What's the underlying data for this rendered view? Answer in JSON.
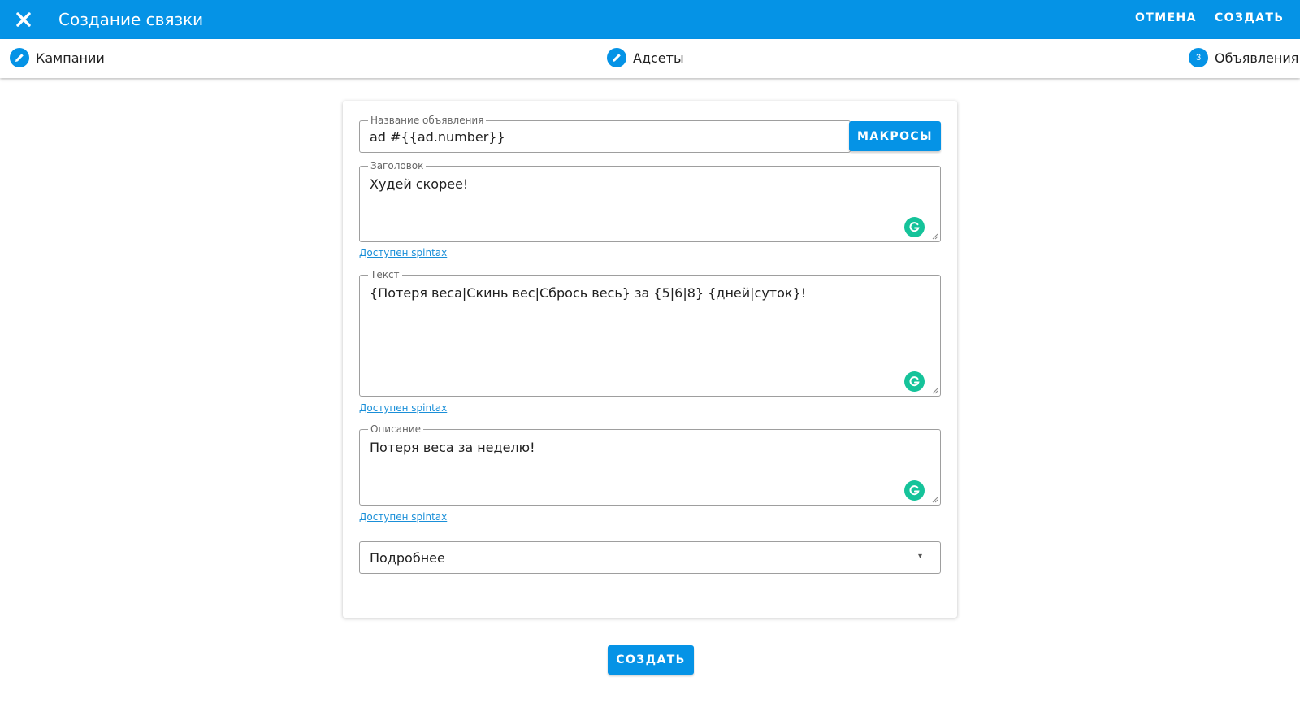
{
  "header": {
    "title": "Создание связки",
    "close_icon": "close-icon",
    "cancel_label": "ОТМЕНА",
    "create_label": "СОЗДАТЬ",
    "bg_color": "#0593e6"
  },
  "stepper": {
    "steps": [
      {
        "label": "Кампании",
        "icon": "pencil-icon",
        "state": "done"
      },
      {
        "label": "Адсеты",
        "icon": "pencil-icon",
        "state": "done"
      },
      {
        "label": "Объявления",
        "number": "3",
        "state": "active"
      }
    ]
  },
  "form": {
    "ad_name": {
      "label": "Название объявления",
      "value": "ad #{{ad.number}}"
    },
    "macros_label": "МАКРОСЫ",
    "headline": {
      "label": "Заголовок",
      "value": "Худей скорее!"
    },
    "text": {
      "label": "Текст",
      "value": "{Потеря веса|Скинь вес|Сбрось весь} за {5|6|8} {дней|суток}!"
    },
    "description": {
      "label": "Описание",
      "value": "Потеря веса за неделю!"
    },
    "spintax_link": "Доступен spintax",
    "cta_select": {
      "value": "Подробнее"
    }
  },
  "submit_label": "СОЗДАТЬ",
  "colors": {
    "accent": "#0593e6",
    "grammarly": "#15c39a",
    "link": "#1a8fd8"
  }
}
